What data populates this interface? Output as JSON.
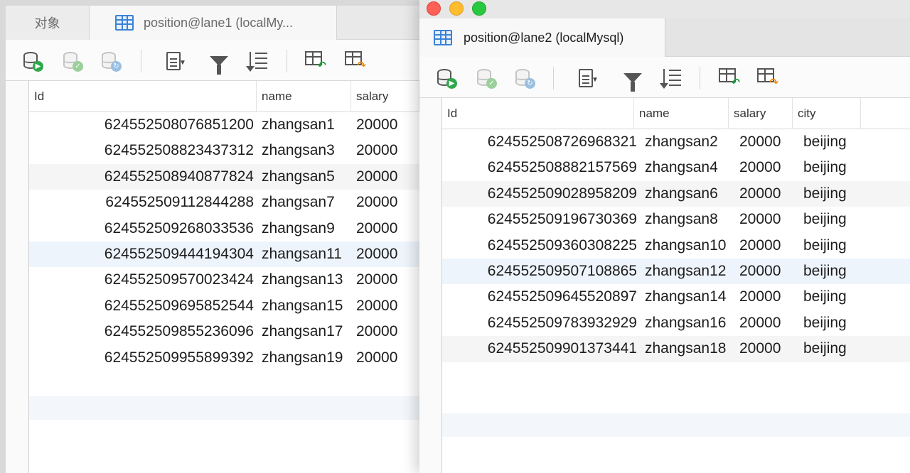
{
  "left_window": {
    "tabs": [
      {
        "label": "对象"
      },
      {
        "label": "position@lane1 (localMy..."
      }
    ],
    "columns": [
      "Id",
      "name",
      "salary"
    ],
    "rows": [
      {
        "id": "624552508076851200",
        "name": "zhangsan1",
        "salary": "20000"
      },
      {
        "id": "624552508823437312",
        "name": "zhangsan3",
        "salary": "20000"
      },
      {
        "id": "624552508940877824",
        "name": "zhangsan5",
        "salary": "20000"
      },
      {
        "id": "624552509112844288",
        "name": "zhangsan7",
        "salary": "20000"
      },
      {
        "id": "624552509268033536",
        "name": "zhangsan9",
        "salary": "20000"
      },
      {
        "id": "624552509444194304",
        "name": "zhangsan11",
        "salary": "20000"
      },
      {
        "id": "624552509570023424",
        "name": "zhangsan13",
        "salary": "20000"
      },
      {
        "id": "624552509695852544",
        "name": "zhangsan15",
        "salary": "20000"
      },
      {
        "id": "624552509855236096",
        "name": "zhangsan17",
        "salary": "20000"
      },
      {
        "id": "624552509955899392",
        "name": "zhangsan19",
        "salary": "20000"
      }
    ]
  },
  "right_window": {
    "tabs": [
      {
        "label": "position@lane2 (localMysql)"
      }
    ],
    "columns": [
      "Id",
      "name",
      "salary",
      "city"
    ],
    "rows": [
      {
        "id": "624552508726968321",
        "name": "zhangsan2",
        "salary": "20000",
        "city": "beijing"
      },
      {
        "id": "624552508882157569",
        "name": "zhangsan4",
        "salary": "20000",
        "city": "beijing"
      },
      {
        "id": "624552509028958209",
        "name": "zhangsan6",
        "salary": "20000",
        "city": "beijing"
      },
      {
        "id": "624552509196730369",
        "name": "zhangsan8",
        "salary": "20000",
        "city": "beijing"
      },
      {
        "id": "624552509360308225",
        "name": "zhangsan10",
        "salary": "20000",
        "city": "beijing"
      },
      {
        "id": "624552509507108865",
        "name": "zhangsan12",
        "salary": "20000",
        "city": "beijing"
      },
      {
        "id": "624552509645520897",
        "name": "zhangsan14",
        "salary": "20000",
        "city": "beijing"
      },
      {
        "id": "624552509783932929",
        "name": "zhangsan16",
        "salary": "20000",
        "city": "beijing"
      },
      {
        "id": "624552509901373441",
        "name": "zhangsan18",
        "salary": "20000",
        "city": "beijing"
      }
    ]
  },
  "toolbar_icons": [
    "db-run-icon",
    "db-commit-icon",
    "db-refresh-icon",
    "text-view-icon",
    "filter-icon",
    "sort-icon",
    "import-icon",
    "export-icon"
  ],
  "colors": {
    "accent": "#3b82d6",
    "run": "#2ea84a",
    "export_arrow": "#f08a00"
  }
}
